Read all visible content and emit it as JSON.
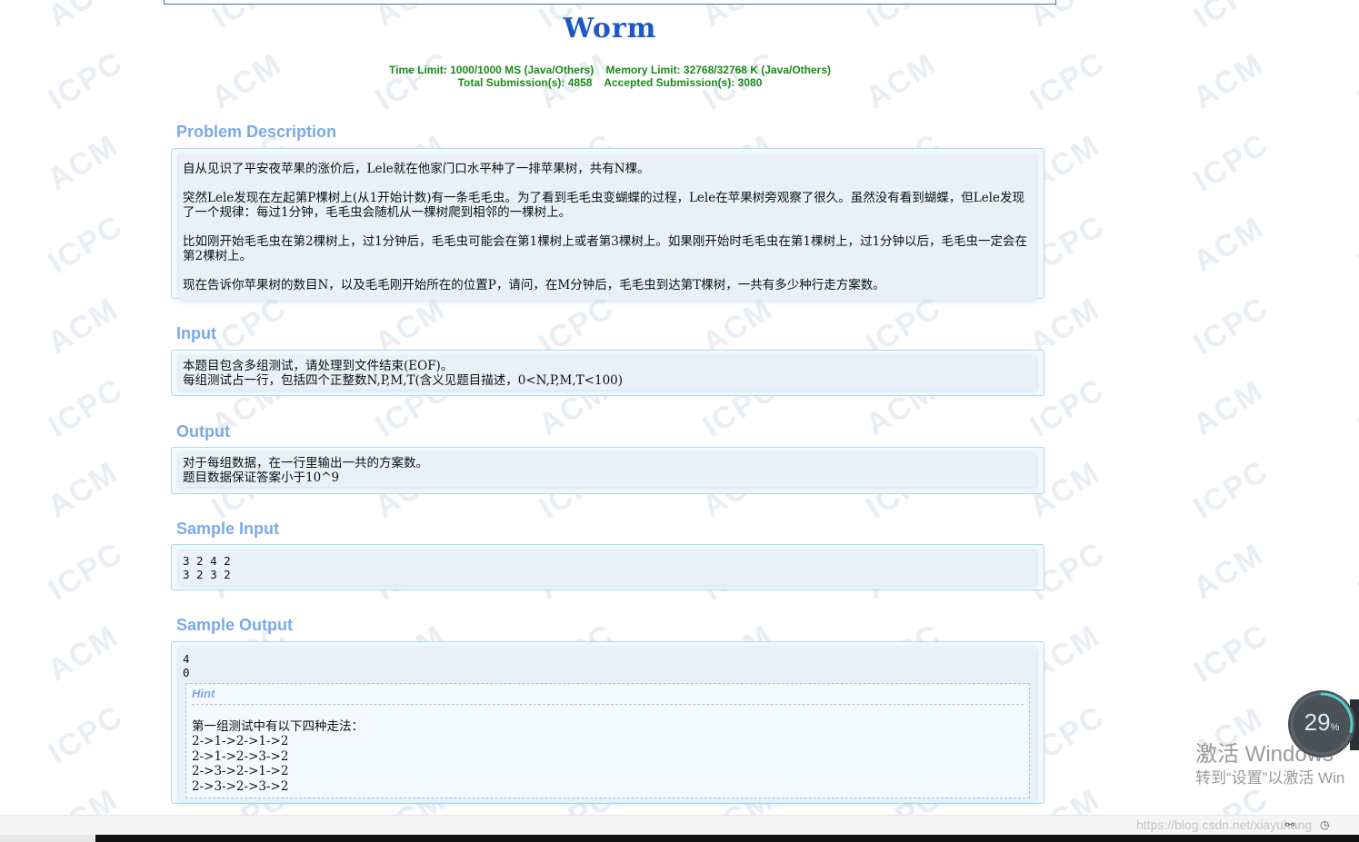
{
  "problem": {
    "title": "Worm",
    "limits_line1": "Time Limit: 1000/1000 MS (Java/Others)    Memory Limit: 32768/32768 K (Java/Others)",
    "limits_line2": "Total Submission(s): 4858    Accepted Submission(s): 3080"
  },
  "sections": {
    "description": {
      "heading": "Problem Description",
      "paragraphs": [
        "自从见识了平安夜苹果的涨价后，Lele就在他家门口水平种了一排苹果树，共有N棵。",
        "突然Lele发现在左起第P棵树上(从1开始计数)有一条毛毛虫。为了看到毛毛虫变蝴蝶的过程，Lele在苹果树旁观察了很久。虽然没有看到蝴蝶，但Lele发现了一个规律：每过1分钟，毛毛虫会随机从一棵树爬到相邻的一棵树上。",
        "比如刚开始毛毛虫在第2棵树上，过1分钟后，毛毛虫可能会在第1棵树上或者第3棵树上。如果刚开始时毛毛虫在第1棵树上，过1分钟以后，毛毛虫一定会在第2棵树上。",
        "现在告诉你苹果树的数目N，以及毛毛刚开始所在的位置P，请问，在M分钟后，毛毛虫到达第T棵树，一共有多少种行走方案数。"
      ]
    },
    "input": {
      "heading": "Input",
      "lines": [
        "本题目包含多组测试，请处理到文件结束(EOF)。",
        "每组测试占一行，包括四个正整数N,P,M,T(含义见题目描述，0<N,P,M,T<100)"
      ]
    },
    "output": {
      "heading": "Output",
      "lines": [
        "对于每组数据，在一行里输出一共的方案数。",
        "题目数据保证答案小于10^9"
      ]
    },
    "sample_input": {
      "heading": "Sample Input",
      "lines": [
        "3 2 4 2",
        "3 2 3 2"
      ]
    },
    "sample_output": {
      "heading": "Sample Output",
      "lines": [
        "4",
        "0"
      ],
      "hint_title": "Hint",
      "hint_lines": [
        "第一组测试中有以下四种走法：",
        "2->1->2->1->2",
        "2->1->2->3->2",
        "2->3->2->1->2",
        "2->3->2->3->2"
      ]
    }
  },
  "overlay": {
    "progress_value": "29",
    "progress_unit": "%",
    "progress_fraction": 0.29,
    "activate_line1": "激活 Windows",
    "activate_line2": "转到“设置”以激活 Win",
    "csdn_url": "https://blog.csdn.net/xiayuhang"
  },
  "watermark_text": [
    "ACM",
    "ICPC"
  ],
  "colors": {
    "title": "#1e58c8",
    "limits": "#1a8a1a",
    "section_heading": "#7ca9e6",
    "panel_border": "#a9dcef"
  }
}
